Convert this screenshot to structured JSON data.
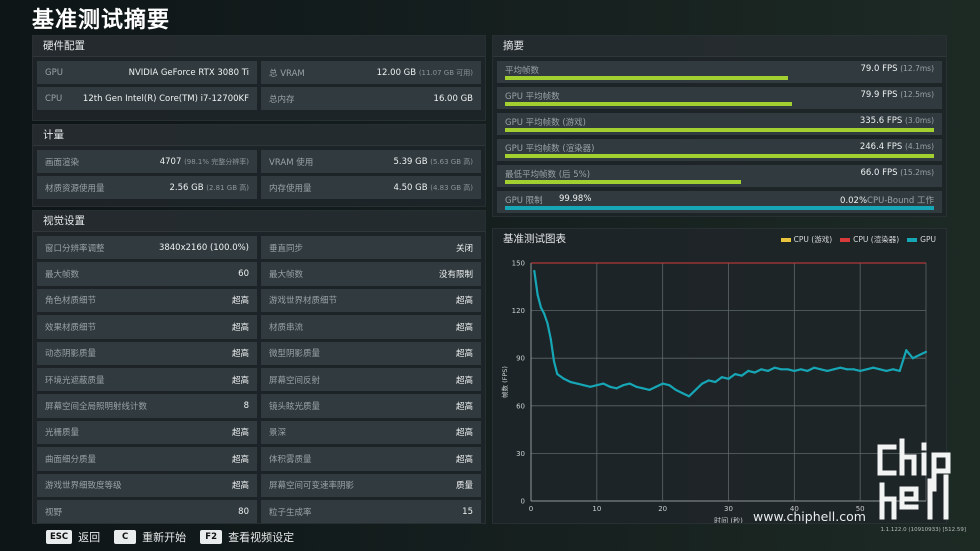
{
  "page": {
    "title": "基准测试摘要"
  },
  "hardware": {
    "title": "硬件配置",
    "rows": [
      [
        {
          "label": "GPU",
          "value": "NVIDIA GeForce RTX 3080 Ti",
          "sub": ""
        },
        {
          "label": "总 VRAM",
          "value": "12.00 GB",
          "sub": "(11.07 GB 可用)"
        }
      ],
      [
        {
          "label": "CPU",
          "value": "12th Gen Intel(R) Core(TM) i7-12700KF",
          "sub": ""
        },
        {
          "label": "总内存",
          "value": "16.00 GB",
          "sub": ""
        }
      ]
    ]
  },
  "metrics": {
    "title": "计量",
    "rows": [
      [
        {
          "label": "画面渲染",
          "value": "4707",
          "sub": "(98.1% 完整分辨率)"
        },
        {
          "label": "VRAM 使用",
          "value": "5.39 GB",
          "sub": "(5.63 GB 高)"
        }
      ],
      [
        {
          "label": "材质资源使用量",
          "value": "2.56 GB",
          "sub": "(2.81 GB 高)"
        },
        {
          "label": "内存使用量",
          "value": "4.50 GB",
          "sub": "(4.83 GB 高)"
        }
      ]
    ]
  },
  "visual": {
    "title": "视觉设置",
    "rows": [
      [
        {
          "label": "窗口分辨率调整",
          "value": "3840x2160 (100.0%)"
        },
        {
          "label": "垂直同步",
          "value": "关闭"
        }
      ],
      [
        {
          "label": "最大帧数",
          "value": "60"
        },
        {
          "label": "最大帧数",
          "value": "没有限制"
        }
      ],
      [
        {
          "label": "角色材质细节",
          "value": "超高"
        },
        {
          "label": "游戏世界材质细节",
          "value": "超高"
        }
      ],
      [
        {
          "label": "效果材质细节",
          "value": "超高"
        },
        {
          "label": "材质串流",
          "value": "超高"
        }
      ],
      [
        {
          "label": "动态阴影质量",
          "value": "超高"
        },
        {
          "label": "微型阴影质量",
          "value": "超高"
        }
      ],
      [
        {
          "label": "环境光遮蔽质量",
          "value": "超高"
        },
        {
          "label": "屏幕空间反射",
          "value": "超高"
        }
      ],
      [
        {
          "label": "屏幕空间全局照明射线计数",
          "value": "8"
        },
        {
          "label": "镜头眩光质量",
          "value": "超高"
        }
      ],
      [
        {
          "label": "光栅质量",
          "value": "超高"
        },
        {
          "label": "景深",
          "value": "超高"
        }
      ],
      [
        {
          "label": "曲面细分质量",
          "value": "超高"
        },
        {
          "label": "体积雾质量",
          "value": "超高"
        }
      ],
      [
        {
          "label": "游戏世界细致度等级",
          "value": "超高"
        },
        {
          "label": "屏幕空间可变速率阴影",
          "value": "质量"
        }
      ],
      [
        {
          "label": "视野",
          "value": "80"
        },
        {
          "label": "粒子生成率",
          "value": "15"
        }
      ]
    ]
  },
  "summary": {
    "title": "摘要",
    "rows": [
      {
        "label": "平均帧数",
        "value": "79.0 FPS",
        "sub": "(12.7ms)",
        "fill": 0.66,
        "color": "#a3d031"
      },
      {
        "label": "GPU 平均帧数",
        "value": "79.9 FPS",
        "sub": "(12.5ms)",
        "fill": 0.67,
        "color": "#a3d031"
      },
      {
        "label": "GPU 平均帧数 (游戏)",
        "value": "335.6 FPS",
        "sub": "(3.0ms)",
        "fill": 1.0,
        "color": "#a3d031"
      },
      {
        "label": "GPU 平均帧数 (渲染器)",
        "value": "246.4 FPS",
        "sub": "(4.1ms)",
        "fill": 1.0,
        "color": "#a3d031"
      },
      {
        "label": "最低平均帧数 (后 5%)",
        "value": "66.0 FPS",
        "sub": "(15.2ms)",
        "fill": 0.55,
        "color": "#a3d031"
      }
    ],
    "gpu_limit": {
      "label": "GPU 限制",
      "left_value": "99.98%",
      "right_value": "0.02%",
      "right_label": "CPU-Bound 工作",
      "fill": 0.9998,
      "color": "#16a6b5"
    }
  },
  "chart_panel": {
    "title": "基准测试图表",
    "legend": [
      {
        "name": "CPU (游戏)",
        "color": "#e8c33c"
      },
      {
        "name": "CPU (渲染器)",
        "color": "#d63a3a"
      },
      {
        "name": "GPU",
        "color": "#16a6b5"
      }
    ]
  },
  "chart_data": {
    "type": "line",
    "title": "基准测试图表",
    "xlabel": "时间 (秒)",
    "ylabel": "帧数 (FPS)",
    "xlim": [
      0,
      60
    ],
    "ylim": [
      0,
      150
    ],
    "xticks": [
      0,
      10,
      20,
      30,
      40,
      50
    ],
    "yticks": [
      0,
      30,
      60,
      90,
      120,
      150
    ],
    "grid": true,
    "legend_position": "top-right",
    "series": [
      {
        "name": "CPU (游戏)",
        "color": "#e8c33c",
        "x": [
          0,
          60
        ],
        "y": [
          150,
          150
        ]
      },
      {
        "name": "CPU (渲染器)",
        "color": "#d63a3a",
        "x": [
          0,
          60
        ],
        "y": [
          150,
          150
        ]
      },
      {
        "name": "GPU",
        "color": "#16a6b5",
        "x": [
          0.5,
          1,
          1.5,
          2,
          2.5,
          3,
          3.5,
          4,
          5,
          6,
          7,
          8,
          9,
          10,
          11,
          12,
          13,
          14,
          15,
          16,
          17,
          18,
          19,
          20,
          21,
          22,
          23,
          24,
          25,
          26,
          27,
          28,
          29,
          30,
          31,
          32,
          33,
          34,
          35,
          36,
          37,
          38,
          39,
          40,
          41,
          42,
          43,
          44,
          45,
          46,
          47,
          48,
          49,
          50,
          51,
          52,
          53,
          54,
          55,
          56,
          57,
          58,
          59,
          60
        ],
        "y": [
          145,
          130,
          122,
          118,
          112,
          102,
          88,
          80,
          77,
          75,
          74,
          73,
          72,
          73,
          74,
          72,
          71,
          73,
          74,
          72,
          71,
          70,
          72,
          74,
          73,
          70,
          68,
          66,
          70,
          74,
          76,
          75,
          78,
          77,
          80,
          79,
          82,
          81,
          83,
          82,
          84,
          83,
          83,
          82,
          83,
          82,
          84,
          83,
          82,
          83,
          84,
          83,
          83,
          82,
          83,
          84,
          83,
          82,
          83,
          82,
          95,
          90,
          92,
          94
        ]
      }
    ]
  },
  "footer": {
    "esc_key": "ESC",
    "esc_label": "返回",
    "c_key": "C",
    "c_label": "重新开始",
    "f2_key": "F2",
    "f2_label": "查看视频设定"
  },
  "watermark": {
    "text": "www.chiphell.com"
  },
  "version": {
    "text": "1.1.122.0 (10910933) [512.59]"
  }
}
